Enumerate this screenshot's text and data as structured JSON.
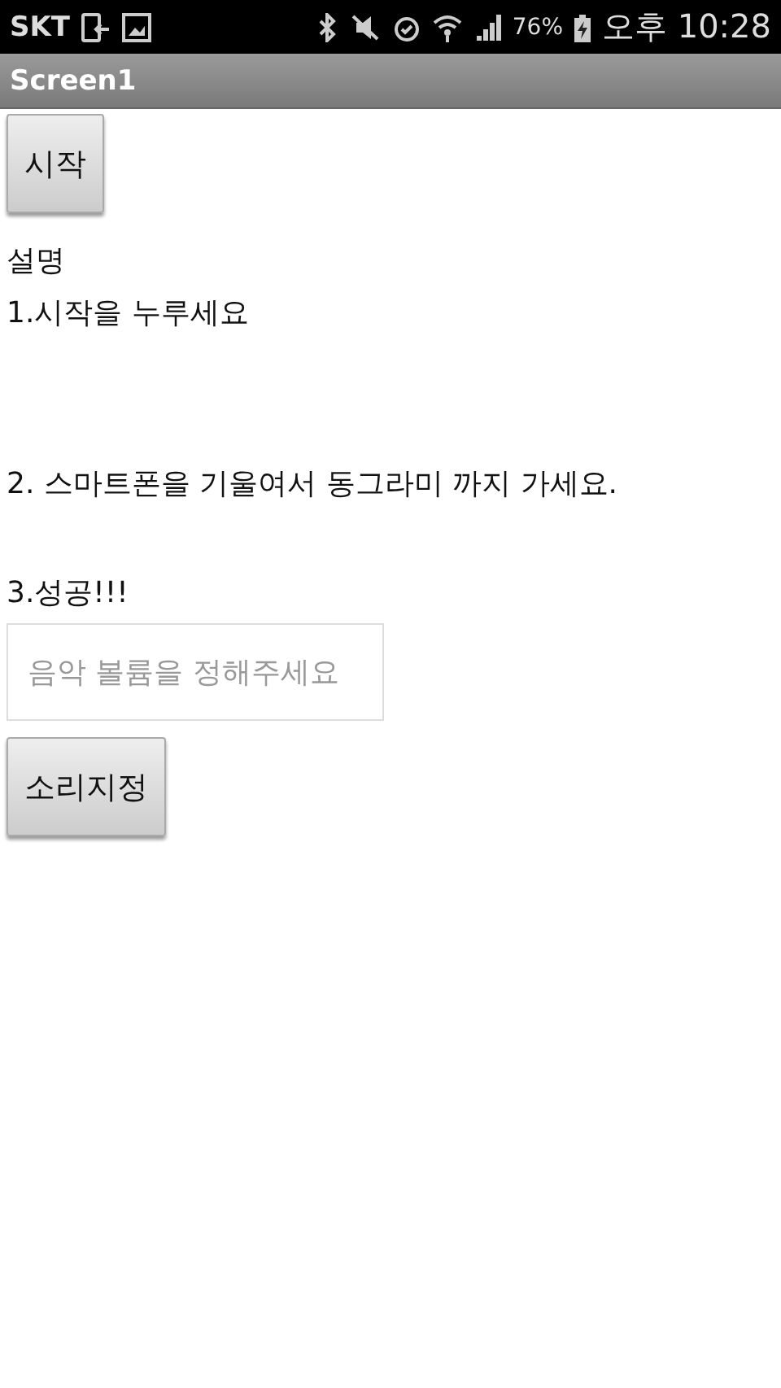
{
  "status_bar": {
    "carrier": "SKT",
    "battery_percent": "76%",
    "time": "오후 10:28"
  },
  "title_bar": {
    "title": "Screen1"
  },
  "start_button": {
    "label": "시작"
  },
  "instructions": [
    {
      "text": "설명"
    },
    {
      "text": "1.시작을 누루세요"
    },
    {
      "text": "2. 스마트폰을 기울여서 동그라미 까지 가세요."
    },
    {
      "text": "3.성공!!!"
    }
  ],
  "volume_field": {
    "placeholder": "음악 볼륨을 정해주세요"
  },
  "sound_button": {
    "label": "소리지정"
  }
}
